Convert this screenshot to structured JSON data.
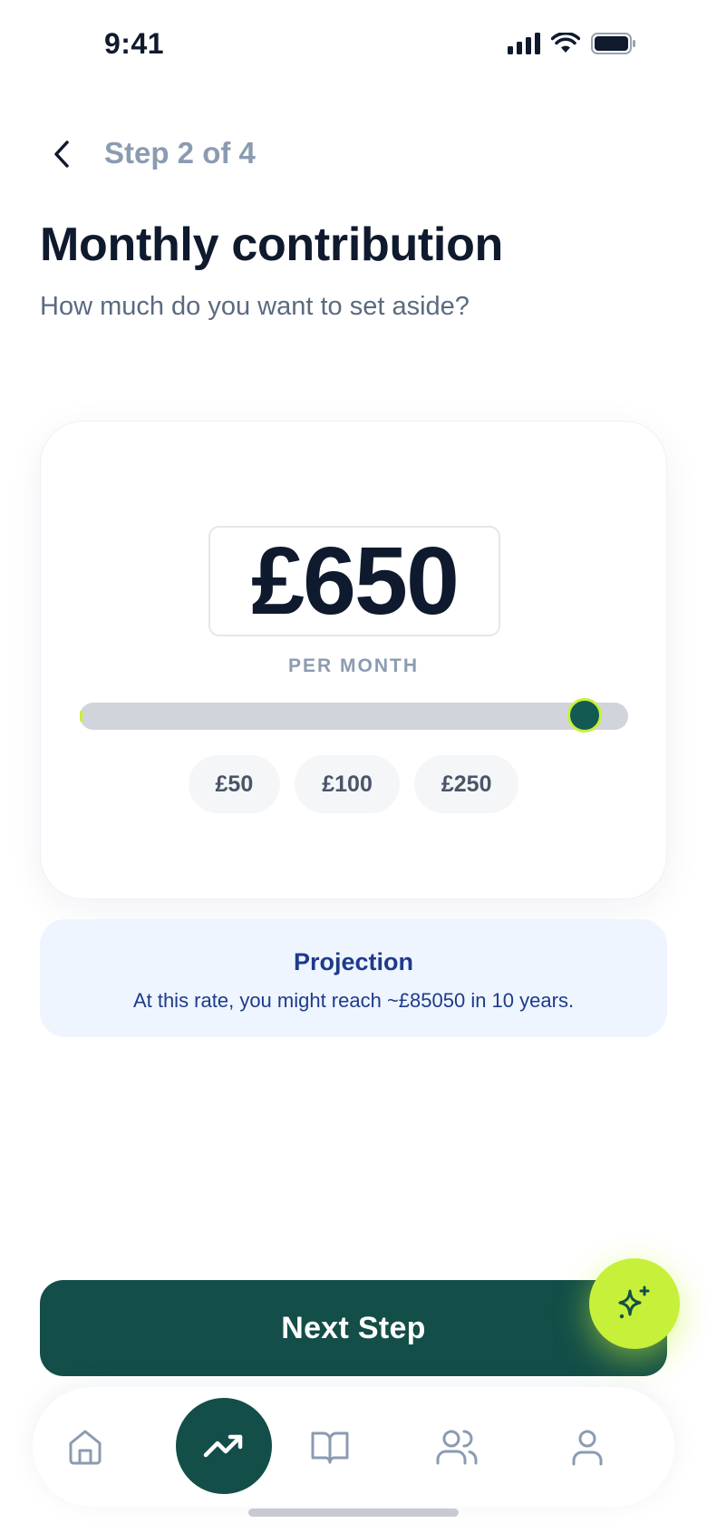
{
  "status_bar": {
    "time": "9:41"
  },
  "header": {
    "step_label": "Step 2 of 4"
  },
  "title": "Monthly contribution",
  "subtitle": "How much do you want to set aside?",
  "amount": {
    "value": "£650",
    "unit_label": "PER MONTH",
    "slider_fraction": 0.92
  },
  "presets": [
    {
      "label": "£50"
    },
    {
      "label": "£100"
    },
    {
      "label": "£250"
    }
  ],
  "projection": {
    "title": "Projection",
    "text": "At this rate, you might reach ~£85050 in 10 years."
  },
  "next_button": {
    "label": "Next Step"
  },
  "nav": {
    "items": [
      {
        "icon": "home-icon"
      },
      {
        "icon": "trending-up-icon",
        "active": true
      },
      {
        "icon": "book-icon"
      },
      {
        "icon": "users-icon"
      },
      {
        "icon": "user-icon"
      }
    ]
  },
  "colors": {
    "primary": "#134e48",
    "accent": "#c6f03a",
    "text_dark": "#0f1a2e",
    "text_muted": "#8b9bb1",
    "projection_bg": "#eef5ff",
    "projection_text": "#1e3a8a"
  }
}
